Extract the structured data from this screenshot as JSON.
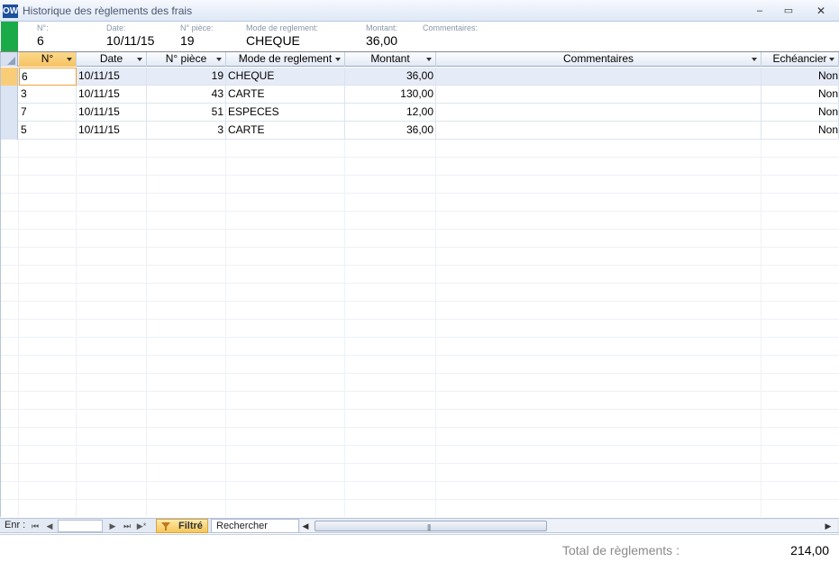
{
  "window": {
    "app_icon": "OW",
    "title": "Historique des règlements des frais",
    "min_glyph": "–",
    "max_glyph": "▭",
    "close_glyph": "✕"
  },
  "header": {
    "num_label": "N°:",
    "num_value": "6",
    "date_label": "Date:",
    "date_value": "10/11/15",
    "piece_label": "N° pièce:",
    "piece_value": "19",
    "mode_label": "Mode de reglement:",
    "mode_value": "CHEQUE",
    "montant_label": "Montant:",
    "montant_value": "36,00",
    "comment_label": "Commentaires:",
    "comment_value": ""
  },
  "columns": [
    "N°",
    "Date",
    "N° pièce",
    "Mode de reglement",
    "Montant",
    "Commentaires",
    "Echéancier"
  ],
  "rows": [
    {
      "num": "6",
      "date": "10/11/15",
      "piece": "19",
      "mode": "CHEQUE",
      "montant": "36,00",
      "comment": "",
      "echeancier": "Non"
    },
    {
      "num": "3",
      "date": "10/11/15",
      "piece": "43",
      "mode": "CARTE",
      "montant": "130,00",
      "comment": "",
      "echeancier": "Non"
    },
    {
      "num": "7",
      "date": "10/11/15",
      "piece": "51",
      "mode": "ESPECES",
      "montant": "12,00",
      "comment": "",
      "echeancier": "Non"
    },
    {
      "num": "5",
      "date": "10/11/15",
      "piece": "3",
      "mode": "CARTE",
      "montant": "36,00",
      "comment": "",
      "echeancier": "Non"
    }
  ],
  "navbar": {
    "label": "Enr :",
    "record_value": "",
    "filter_label": "Filtré",
    "search_label": "Rechercher"
  },
  "footer": {
    "total_label": "Total de règlements :",
    "total_value": "214,00"
  }
}
